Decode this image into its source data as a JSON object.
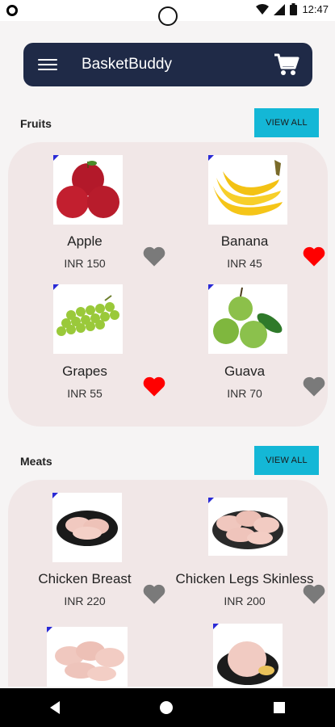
{
  "status": {
    "time": "12:47"
  },
  "appbar": {
    "title": "BasketBuddy"
  },
  "sections": {
    "fruits": {
      "title": "Fruits",
      "view_all": "VIEW ALL"
    },
    "meats": {
      "title": "Meats",
      "view_all": "VIEW ALL"
    }
  },
  "products": {
    "apple": {
      "name": "Apple",
      "price": "INR 150",
      "favorite": false
    },
    "banana": {
      "name": "Banana",
      "price": "INR 45",
      "favorite": true
    },
    "grapes": {
      "name": "Grapes",
      "price": "INR 55",
      "favorite": true
    },
    "guava": {
      "name": "Guava",
      "price": "INR 70",
      "favorite": false
    },
    "chicken_breast": {
      "name": "Chicken Breast",
      "price": "INR 220",
      "favorite": false
    },
    "chicken_legs": {
      "name": "Chicken Legs Skinless",
      "price": "INR 200",
      "favorite": false
    }
  },
  "colors": {
    "appbar": "#1f2a47",
    "accent": "#14b7d6",
    "favorite_on": "#ff0000",
    "favorite_off": "#7a7a7a",
    "card": "#f1e7e7"
  }
}
